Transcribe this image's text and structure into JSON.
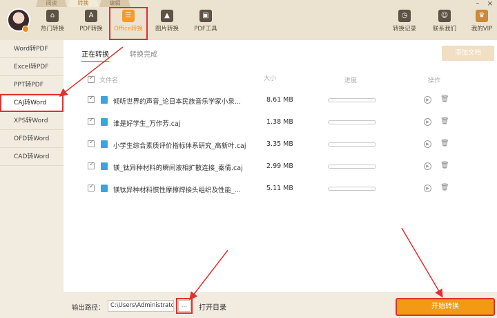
{
  "mode_tabs": [
    "阅读",
    "转换",
    "编辑"
  ],
  "nav": {
    "items": [
      {
        "label": "热门转换",
        "icon": "house-icon"
      },
      {
        "label": "PDF转换",
        "icon": "pdf-icon"
      },
      {
        "label": "Office转换",
        "icon": "office-doc-icon"
      },
      {
        "label": "图片转换",
        "icon": "image-icon"
      },
      {
        "label": "PDF工具",
        "icon": "toolbox-icon"
      }
    ],
    "right_items": [
      {
        "label": "转换记录",
        "icon": "history-icon"
      },
      {
        "label": "联系我们",
        "icon": "support-icon"
      },
      {
        "label": "我的VIP",
        "icon": "crown-icon"
      }
    ]
  },
  "window_controls": {
    "minimize": "–",
    "close": "×"
  },
  "sidebar": {
    "items": [
      "Word转PDF",
      "Excel转PDF",
      "PPT转PDF",
      "CAJ转Word",
      "XPS转Word",
      "OFD转Word",
      "CAD转Word"
    ]
  },
  "main": {
    "tabs": [
      "正在转换",
      "转换完成"
    ],
    "add_button": "添加文档",
    "columns": {
      "name": "文件名",
      "size": "大小",
      "progress": "进度",
      "actions": "操作"
    },
    "files": [
      {
        "name": "倾听世界的声音_论日本民族音乐学家小泉...",
        "size": "8.61 MB",
        "progress": 0
      },
      {
        "name": "谁是好学生_万作芳.caj",
        "size": "1.38 MB",
        "progress": 0
      },
      {
        "name": "小学生综合素质评价指标体系研究_高新叶.caj",
        "size": "3.35 MB",
        "progress": 0
      },
      {
        "name": "镁_钛异种材料的瞬间液相扩散连接_秦倩.caj",
        "size": "2.99 MB",
        "progress": 0
      },
      {
        "name": "镁钛异种材料惯性摩擦焊接头组织及性能_...",
        "size": "5.11 MB",
        "progress": 0
      }
    ]
  },
  "bottom": {
    "output_label": "输出路径：",
    "output_path": "C:\\Users\\Administrator",
    "browse": "...",
    "open_dir": "打开目录",
    "start": "开始转换"
  },
  "colors": {
    "accent": "#f29a2e",
    "highlight": "#e03030"
  }
}
